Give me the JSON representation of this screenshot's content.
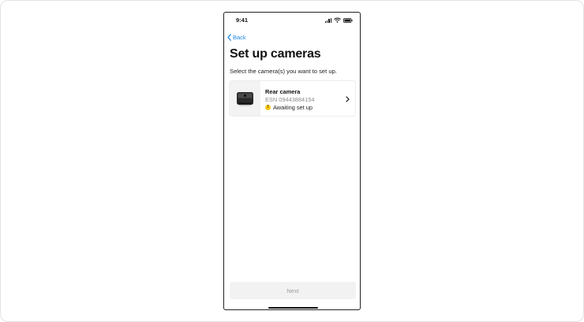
{
  "status_bar": {
    "time": "9:41",
    "icons": [
      "signal-icon",
      "wifi-icon",
      "battery-icon"
    ]
  },
  "nav": {
    "back_label": "Back",
    "back_icon": "chevron-left-icon"
  },
  "page": {
    "title": "Set up cameras",
    "subtitle": "Select the camera(s) you want to set up."
  },
  "cameras": [
    {
      "name": "Rear camera",
      "esn": "ESN  09443884154",
      "status": "Awaiting set up",
      "status_icon": "warning-icon",
      "thumbnail_icon": "camera-device-icon"
    }
  ],
  "footer": {
    "next_label": "Next",
    "next_enabled": false
  },
  "colors": {
    "accent": "#1e88e5",
    "warning": "#f5c518",
    "disabled_button_bg": "#f2f2f2",
    "disabled_button_text": "#9e9e9e"
  }
}
